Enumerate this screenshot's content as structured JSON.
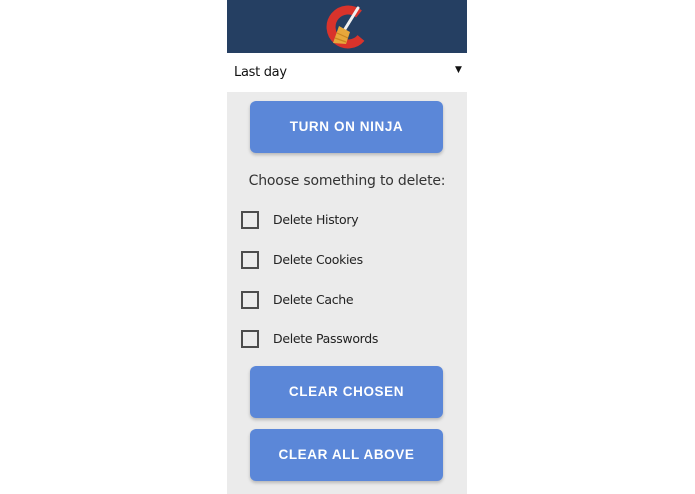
{
  "header": {
    "logo_icon": "ccleaner-logo-icon",
    "background": "#253f62"
  },
  "range_select": {
    "value": "Last day",
    "arrow": "▼"
  },
  "buttons": {
    "ninja": "TURN ON NINJA",
    "clear_chosen": "CLEAR CHOSEN",
    "clear_all": "CLEAR ALL ABOVE",
    "color": "#5b87d8"
  },
  "prompt": "Choose something to delete:",
  "options": [
    {
      "label": "Delete History",
      "checked": false
    },
    {
      "label": "Delete Cookies",
      "checked": false
    },
    {
      "label": "Delete Cache",
      "checked": false
    },
    {
      "label": "Delete Passwords",
      "checked": false
    }
  ]
}
